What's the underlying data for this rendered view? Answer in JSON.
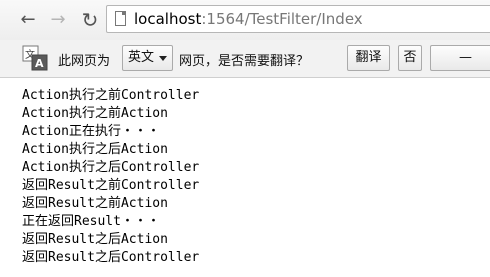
{
  "browser": {
    "url_host": "localhost",
    "url_rest": ":1564/TestFilter/Index"
  },
  "translate_bar": {
    "prompt": "此网页为",
    "language": "英文",
    "question": "网页，是否需要翻译？",
    "translate_label": "翻译",
    "no_label": "否"
  },
  "content": {
    "lines": [
      "Action执行之前Controller",
      "Action执行之前Action",
      "Action正在执行・・・",
      "Action执行之后Action",
      "Action执行之后Controller",
      "返回Result之前Controller",
      "返回Result之前Action",
      "正在返回Result・・・",
      "返回Result之后Action",
      "返回Result之后Controller"
    ]
  }
}
